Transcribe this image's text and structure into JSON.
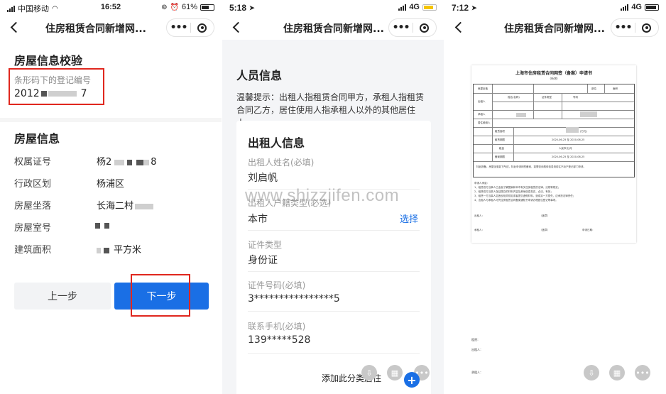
{
  "screens": [
    {
      "status": {
        "carrier": "中国移动",
        "time": "16:52",
        "battery": "61%",
        "battery_level": 0.61
      },
      "nav_title": "住房租赁合同新增网...",
      "verify": {
        "title": "房屋信息校验",
        "barcode_label": "条形码下的登记编号",
        "barcode_prefix": "2012",
        "barcode_suffix": "7"
      },
      "info": {
        "title": "房屋信息",
        "rows": [
          {
            "label": "权属证号",
            "prefix": "杨2",
            "suffix": "8"
          },
          {
            "label": "行政区划",
            "prefix": "杨浦区",
            "suffix": ""
          },
          {
            "label": "房屋坐落",
            "prefix": "长海二村",
            "suffix": ""
          },
          {
            "label": "房屋室号",
            "prefix": "",
            "suffix": ""
          },
          {
            "label": "建筑面积",
            "prefix": "",
            "suffix": "平方米"
          }
        ]
      },
      "buttons": {
        "prev": "上一步",
        "next": "下一步"
      }
    },
    {
      "status": {
        "time": "5:18",
        "network": "4G",
        "battery_level": 0.8
      },
      "nav_title": "住房租赁合同新增网...",
      "title": "人员信息",
      "tip": "温馨提示：出租人指租赁合同甲方，承租人指租赁合同乙方，居住使用人指承租人以外的其他居住人。",
      "card": {
        "title": "出租人信息",
        "fields": [
          {
            "label": "出租人姓名(必填)",
            "value": "刘启帆"
          },
          {
            "label": "出租人户籍类型(必选)",
            "value": "本市",
            "action": "选择"
          },
          {
            "label": "证件类型",
            "value": "身份证"
          },
          {
            "label": "证件号码(必填)",
            "value": "3****************5"
          },
          {
            "label": "联系手机(必填)",
            "value": "139*****528"
          }
        ]
      },
      "bottom_text": "添加此分类居住",
      "watermark": "www.shizzjifen.com"
    },
    {
      "status": {
        "time": "7:12",
        "network": "4G",
        "battery_level": 0.9
      },
      "nav_title": "住房租赁合同新增网...",
      "doc": {
        "title": "上海市住房租赁合同网签（备案）申请书",
        "subtitle": "(新增)",
        "cells": [
          "房屋坐落",
          "部位",
          "面积",
          "出租人",
          "姓名(名称)",
          "证件类型",
          "号码",
          "承租人",
          "居住使用人",
          "租赁面积",
          "租赁期限",
          "租金",
          "备案期限",
          "2020-06-25 至 2020-06-25",
          "人民币元/月",
          "2020-06-25 至 2020-06-25",
          "(万元)"
        ],
        "paragraph": "特此报备，房屋坐落如下所述，特此申请网签备案，如需查询具体信息请前往不动产登记部门申请。",
        "promises": [
          "申请人承诺：",
          "1、租赁双方当事人已全面了解国家和本市有关住房租赁的法律、法规等规定；",
          "2、租赁双方当事人保证提交的材料内容及其他信息真实、合法、有效；",
          "3、租赁一方当事人如违反相关规定或者提交虚假材料，造成另一方损失，应承担法律责任；",
          "4、出租人与承租人可凭住房租赁合同备案通知书申请办理居住登记等事项。"
        ],
        "signatures": {
          "lessor": "出租人：",
          "seal": "（盖章）",
          "lessee": "承租人：",
          "date": "申请日期："
        }
      },
      "footer_labels": [
        "租赁：",
        "出租人：",
        "承租人："
      ]
    }
  ]
}
